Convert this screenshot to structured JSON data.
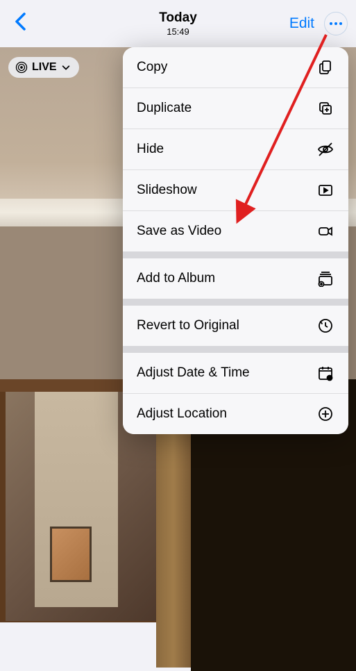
{
  "header": {
    "title": "Today",
    "time": "15:49",
    "edit_label": "Edit"
  },
  "live_badge": {
    "label": "LIVE"
  },
  "menu": {
    "sections": [
      [
        {
          "label": "Copy",
          "icon": "copy"
        },
        {
          "label": "Duplicate",
          "icon": "duplicate"
        },
        {
          "label": "Hide",
          "icon": "hide"
        },
        {
          "label": "Slideshow",
          "icon": "slideshow"
        },
        {
          "label": "Save as Video",
          "icon": "video"
        }
      ],
      [
        {
          "label": "Add to Album",
          "icon": "album"
        }
      ],
      [
        {
          "label": "Revert to Original",
          "icon": "revert"
        }
      ],
      [
        {
          "label": "Adjust Date & Time",
          "icon": "calendar"
        },
        {
          "label": "Adjust Location",
          "icon": "location"
        }
      ]
    ]
  },
  "annotation": {
    "arrow_target": "save-as-video"
  }
}
